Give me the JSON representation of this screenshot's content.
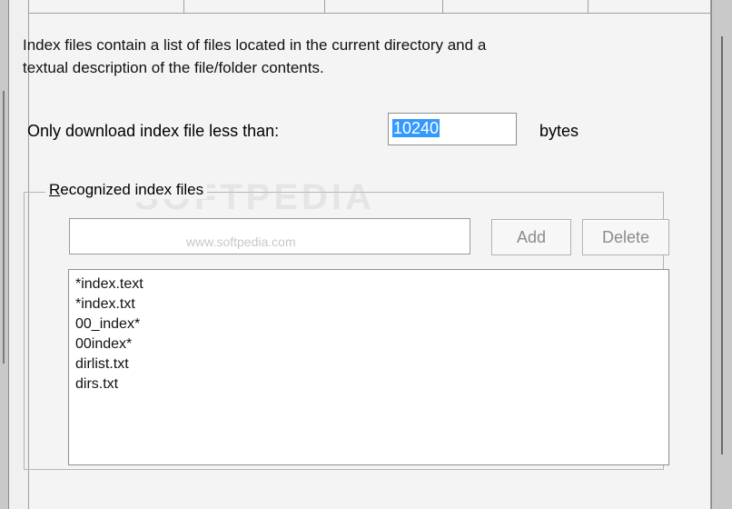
{
  "description": {
    "line1": "Index files contain a list of files located in the current directory and a",
    "line2": "textual description of the file/folder contents."
  },
  "download_limit": {
    "label": "Only download index file less than:",
    "value": "10240",
    "unit": "bytes"
  },
  "recognized": {
    "legend_first_letter": "R",
    "legend_rest": "ecognized index files",
    "entry_value": "",
    "add_label": "Add",
    "delete_label": "Delete",
    "items": [
      "*index.text",
      "*index.txt",
      "00_index*",
      "00index*",
      "dirlist.txt",
      "dirs.txt"
    ]
  },
  "watermark": {
    "big": "SOFTPEDIA",
    "url": "www.softpedia.com"
  }
}
